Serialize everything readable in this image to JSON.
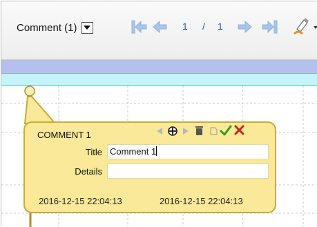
{
  "toolbar": {
    "comment_select": {
      "value": "Comment (1)"
    },
    "nav_icons": [
      "first-page-icon",
      "previous-page-icon",
      "next-page-icon",
      "last-page-icon"
    ],
    "page": {
      "current": "1",
      "separator": "/",
      "total": "1"
    },
    "tool_icon": "highlighter-pen-icon"
  },
  "comment": {
    "title_label": "COMMENT 1",
    "field_title_label": "Title",
    "field_title_value": "Comment 1",
    "field_details_label": "Details",
    "field_details_value": "",
    "created": "2016-12-15 22:04:13",
    "modified": "2016-12-15 22:04:13",
    "action_icons": [
      "previous-comment-icon",
      "move-icon",
      "next-comment-icon",
      "delete-icon",
      "copy-icon",
      "confirm-icon",
      "close-icon"
    ]
  },
  "colors": {
    "callout_bg": "#f9e998",
    "callout_border": "#c9a93c",
    "band_blue": "#b6c0ec",
    "band_cyan": "#c4f4f8",
    "nav_icon": "#a9c6ea",
    "page_text": "#2d5fb0",
    "confirm": "#2e9e1f",
    "close": "#c8261c"
  }
}
